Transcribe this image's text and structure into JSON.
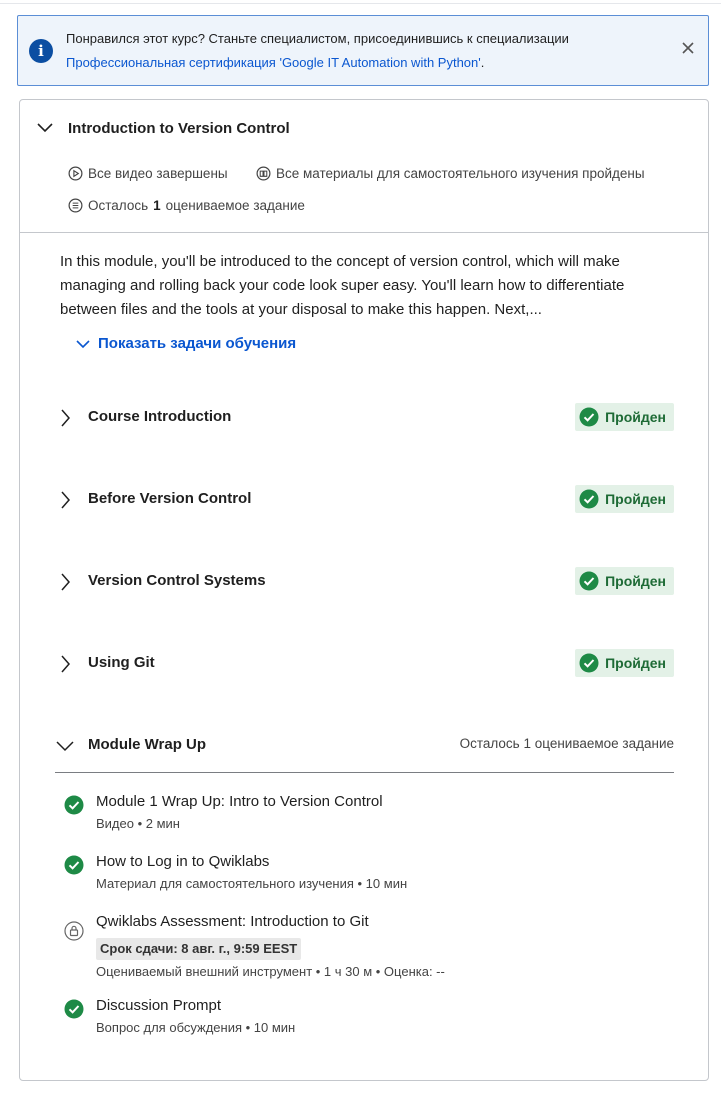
{
  "banner": {
    "text": "Понравился этот курс? Станьте специалистом, присоединившись к специализации",
    "link": "Профессиональная сертификация 'Google IT Automation with Python'",
    "link_suffix": ".",
    "info_icon": "info-icon",
    "close_icon": "close-icon"
  },
  "module": {
    "title": "Introduction to Version Control",
    "meta_videos": "Все видео завершены",
    "meta_readings": "Все материалы для самостоятельного изучения пройдены",
    "meta_remaining_prefix": "Осталось",
    "meta_remaining_count": "1",
    "meta_remaining_suffix": "оцениваемое задание",
    "description": "In this module, you'll be introduced to the concept of version control, which will make managing and rolling back your code look super easy. You'll learn how to differentiate between files and the tools at your disposal to make this happen. Next,...",
    "show_tasks_label": "Показать задачи обучения"
  },
  "lessons": [
    {
      "title": "Course Introduction",
      "status": "Пройден"
    },
    {
      "title": "Before Version Control",
      "status": "Пройден"
    },
    {
      "title": "Version Control Systems",
      "status": "Пройден"
    },
    {
      "title": "Using Git",
      "status": "Пройден"
    }
  ],
  "wrapup": {
    "title": "Module Wrap Up",
    "remaining": "Осталось 1 оцениваемое задание",
    "items": [
      {
        "title": "Module 1 Wrap Up: Intro to Version Control",
        "sub": "Видео • 2 мин",
        "status": "completed"
      },
      {
        "title": "How to Log in to Qwiklabs",
        "sub": "Материал для самостоятельного изучения • 10 мин",
        "status": "completed"
      },
      {
        "title": "Qwiklabs Assessment: Introduction to Git",
        "due": "Срок сдачи: 8 авг. г., 9:59 EEST",
        "sub": "Оцениваемый внешний инструмент • 1 ч 30 м • Оценка: --",
        "status": "locked"
      },
      {
        "title": "Discussion Prompt",
        "sub": "Вопрос для обсуждения • 10 мин",
        "status": "completed"
      }
    ]
  },
  "colors": {
    "accent": "#0b57d0",
    "success": "#1e8a46",
    "badge_bg": "#e3f1e7",
    "banner_bg": "#eef4fb"
  }
}
